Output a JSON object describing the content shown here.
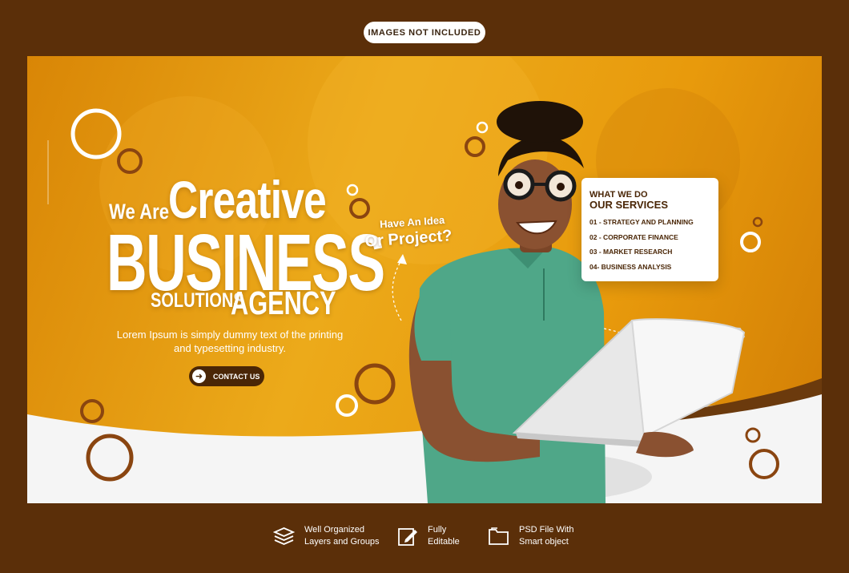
{
  "banner": {
    "label": "IMAGES NOT INCLUDED"
  },
  "hero": {
    "we_are": "We Are",
    "creative": "Creative",
    "business": "BUSINESS",
    "solutions": "SOLUTIONS",
    "agency": "AGENCY",
    "description": "Lorem Ipsum is simply dummy text of the printing and typesetting industry.",
    "cta_label": "CONTACT US",
    "cta_icon": "arrow-right-icon"
  },
  "callout": {
    "line1": "Have An Idea",
    "line2": "Or Project?"
  },
  "services": {
    "heading1": "WHAT WE DO",
    "heading2": "OUR SERVICES",
    "items": [
      "01 - STRATEGY AND PLANNING",
      "02 - CORPORATE FINANCE",
      "03 - MARKET RESEARCH",
      "04- BUSINESS ANALYSIS"
    ]
  },
  "features": [
    {
      "icon": "layers-icon",
      "line1": "Well Organized",
      "line2": "Layers and Groups"
    },
    {
      "icon": "edit-icon",
      "line1": "Fully",
      "line2": "Editable"
    },
    {
      "icon": "folder-icon",
      "line1": "PSD File With",
      "line2": "Smart object"
    }
  ],
  "colors": {
    "frame": "#5b2f09",
    "accent": "#e99a0b",
    "dark_brown": "#4a2606",
    "white": "#ffffff"
  }
}
